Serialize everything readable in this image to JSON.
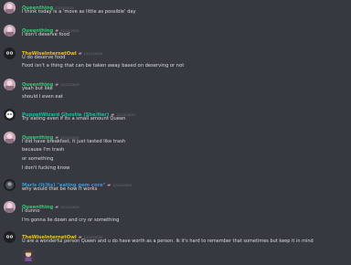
{
  "colors": {
    "background": "#36393f",
    "queen": "#2ecc71",
    "owl": "#f1c40f",
    "puppet": "#1abc9c",
    "maris": "#3498db",
    "text": "#dcddde",
    "timestamp": "#72767d"
  },
  "badge_icon": "pink-badge-icon",
  "messages": [
    {
      "author": "Queenthing",
      "time": "12/12/2020",
      "lines": [
        "I think today is a 'move as little as possible' day"
      ]
    },
    {
      "author": "Queenthing",
      "time": "12/12/2020",
      "lines": [
        "I don't deserve food"
      ]
    },
    {
      "author": "TheWiseInternetOwl",
      "time": "12/12/2020",
      "lines": [
        "U do deserve food",
        "Food isn't a thing that can be taken away based on deserving or not"
      ]
    },
    {
      "author": "Queenthing",
      "time": "12/12/2020",
      "lines": [
        "yeah but like",
        "should I even eat"
      ]
    },
    {
      "author": "PuppetWizard Ghostie (She/Her)",
      "time": "12/12/2020",
      "lines": [
        "Try eating even if its a small amount Queen"
      ]
    },
    {
      "author": "Queenthing",
      "time": "12/12/2020",
      "lines": [
        "I did have breakfast, it just tasted like trash",
        "because I'm trash",
        "or something",
        "I don't fucking know"
      ]
    },
    {
      "author": "Maris (It/Its) \"eating gem core\"",
      "time": "12/12/2020",
      "lines": [
        "why would that be how it works"
      ]
    },
    {
      "author": "Queenthing",
      "time": "12/12/2020",
      "lines": [
        "I dunno",
        "I'm gonna lie down and cry or something"
      ]
    },
    {
      "author": "TheWiseInternetOwl",
      "time": "12/12/2020",
      "lines": [
        "U are a wonderful person Queen and u do have worth as a person. Ik it's hard to remember that sometimes but keep it in mind"
      ]
    }
  ]
}
